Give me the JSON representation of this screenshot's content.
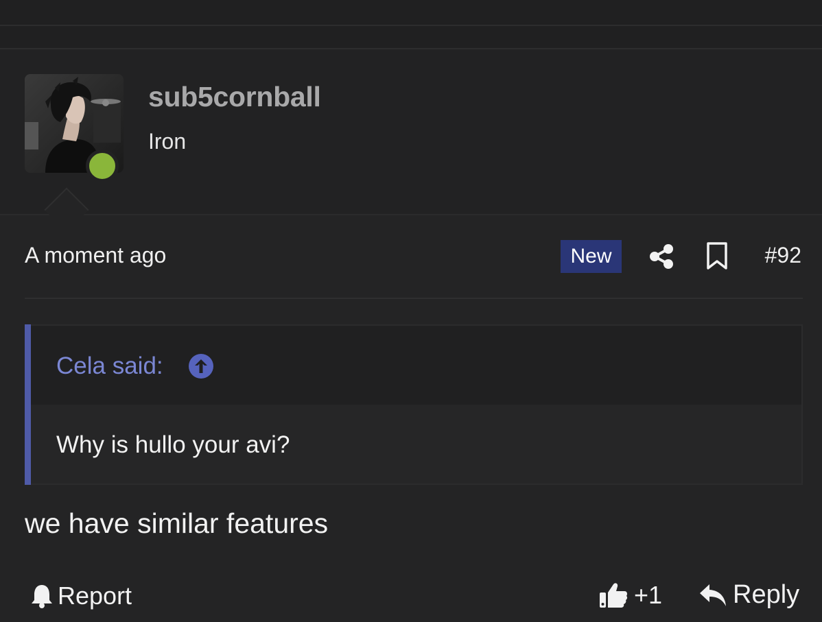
{
  "post": {
    "author": {
      "username": "sub5cornball",
      "title": "Iron",
      "online_color": "#8ab63a"
    },
    "meta": {
      "time": "A moment ago",
      "badge": "New",
      "post_number": "#92"
    },
    "quote": {
      "author_label": "Cela said:",
      "text": "Why is hullo your avi?"
    },
    "message": "we have similar features",
    "actions": {
      "report": "Report",
      "like_count": "+1",
      "reply": "Reply"
    }
  },
  "colors": {
    "accent": "#4f5ba8",
    "badge": "#2a3677",
    "quote_author": "#7b87d4"
  }
}
